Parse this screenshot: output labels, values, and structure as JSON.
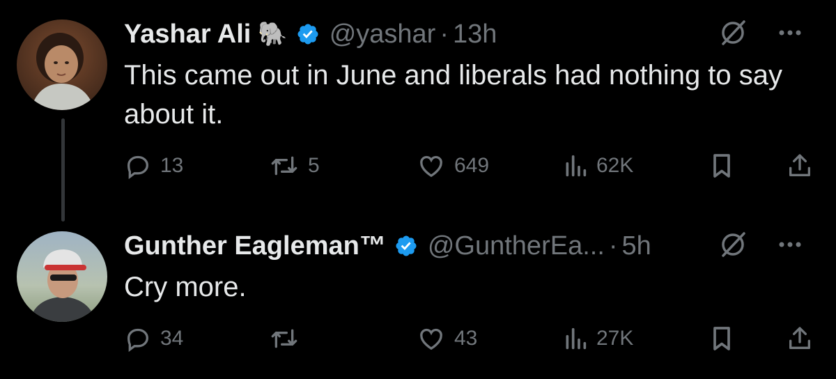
{
  "tweets": [
    {
      "name": "Yashar Ali",
      "emoji": "🐘",
      "handle": "@yashar",
      "separator": "·",
      "time": "13h",
      "text": "This came out in June and liberals had nothing to say about it.",
      "stats": {
        "replies": "13",
        "reposts": "5",
        "likes": "649",
        "views": "62K"
      }
    },
    {
      "name": "Gunther Eagleman™",
      "handle": "@GuntherEa...",
      "separator": "·",
      "time": "5h",
      "text": "Cry more.",
      "stats": {
        "replies": "34",
        "reposts": "",
        "likes": "43",
        "views": "27K"
      }
    }
  ],
  "colors": {
    "background": "#000000",
    "text": "#e7e9ea",
    "secondary": "#71767b",
    "verified": "#1d9bf0",
    "thread_line": "#333639"
  },
  "icons": [
    "verified-badge-icon",
    "grok-slash-icon",
    "more-icon",
    "reply-icon",
    "repost-icon",
    "like-icon",
    "views-icon",
    "bookmark-icon",
    "share-icon"
  ]
}
